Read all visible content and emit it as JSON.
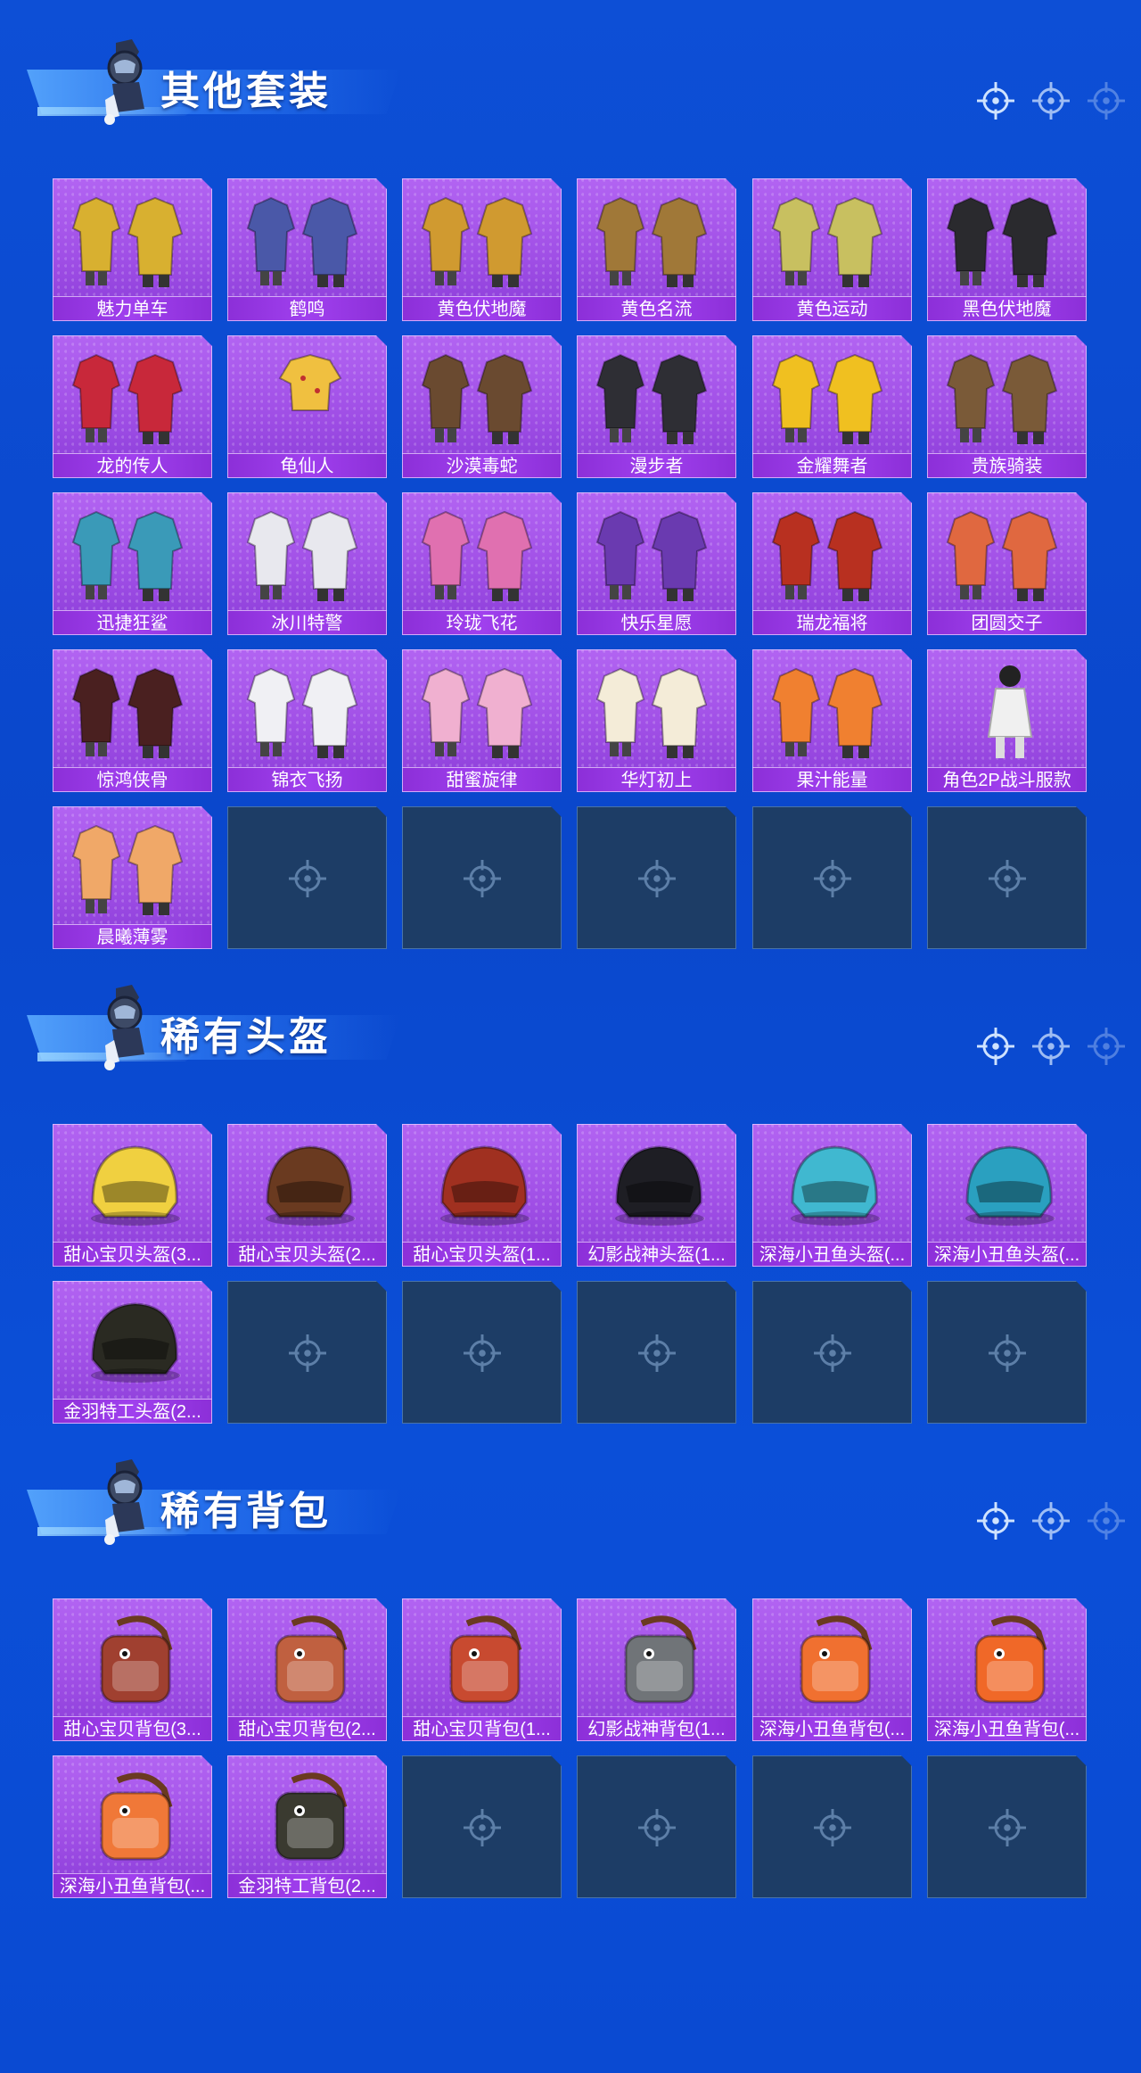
{
  "colors": {
    "background": "#0b4bd3",
    "tile": "#a04fe6",
    "label": "#8c2fd8",
    "empty": "#1d3d66"
  },
  "sections": [
    {
      "title": "其他套装",
      "items": [
        {
          "label": "魅力单车",
          "icon": "outfit-icon",
          "color": "#d8b030"
        },
        {
          "label": "鹤鸣",
          "icon": "jacket-icon",
          "color": "#4a58a8"
        },
        {
          "label": "黄色伏地魔",
          "icon": "hoodie-icon",
          "color": "#d09a30"
        },
        {
          "label": "黄色名流",
          "icon": "suit-icon",
          "color": "#a07838"
        },
        {
          "label": "黄色运动",
          "icon": "sport-outfit-icon",
          "color": "#c8c060"
        },
        {
          "label": "黑色伏地魔",
          "icon": "hoodie-icon",
          "color": "#2a2a2e"
        },
        {
          "label": "龙的传人",
          "icon": "robe-icon",
          "color": "#c8283a"
        },
        {
          "label": "龟仙人",
          "icon": "shirt-icon",
          "color": "#f0c040"
        },
        {
          "label": "沙漠毒蛇",
          "icon": "outfit-icon",
          "color": "#6a4a30"
        },
        {
          "label": "漫步者",
          "icon": "outfit-icon",
          "color": "#2e2e34"
        },
        {
          "label": "金耀舞者",
          "icon": "jacket-icon",
          "color": "#f0c020"
        },
        {
          "label": "贵族骑装",
          "icon": "outfit-icon",
          "color": "#7a5a38"
        },
        {
          "label": "迅捷狂鲨",
          "icon": "shark-outfit-icon",
          "color": "#3a9ab8"
        },
        {
          "label": "冰川特警",
          "icon": "jacket-icon",
          "color": "#e8e8ee"
        },
        {
          "label": "玲珑飞花",
          "icon": "dress-icon",
          "color": "#e070b0"
        },
        {
          "label": "快乐星愿",
          "icon": "armor-icon",
          "color": "#6a3ab0"
        },
        {
          "label": "瑞龙福将",
          "icon": "armor-icon",
          "color": "#b83020"
        },
        {
          "label": "团圆交子",
          "icon": "robe-icon",
          "color": "#e06840"
        },
        {
          "label": "惊鸿侠骨",
          "icon": "robe-icon",
          "color": "#4a2020"
        },
        {
          "label": "锦衣飞扬",
          "icon": "robe-icon",
          "color": "#f0f0f4"
        },
        {
          "label": "甜蜜旋律",
          "icon": "dress-icon",
          "color": "#f0b0d0"
        },
        {
          "label": "华灯初上",
          "icon": "robe-icon",
          "color": "#f4ecd8"
        },
        {
          "label": "果汁能量",
          "icon": "jacket-icon",
          "color": "#f08030"
        },
        {
          "label": "角色2P战斗服款",
          "icon": "figure-icon",
          "color": "#f0f0f0"
        },
        {
          "label": "晨曦薄雾",
          "icon": "dress-icon",
          "color": "#f0a868"
        }
      ],
      "empty_slots": 5
    },
    {
      "title": "稀有头盔",
      "items": [
        {
          "label": "甜心宝贝头盔(3...",
          "icon": "helmet-icon",
          "color": "#f0d040"
        },
        {
          "label": "甜心宝贝头盔(2...",
          "icon": "helmet-icon",
          "color": "#6a3a20"
        },
        {
          "label": "甜心宝贝头盔(1...",
          "icon": "helmet-icon",
          "color": "#a03020"
        },
        {
          "label": "幻影战神头盔(1...",
          "icon": "helmet-icon",
          "color": "#1e1e24"
        },
        {
          "label": "深海小丑鱼头盔(...",
          "icon": "helmet-icon",
          "color": "#40b8d0"
        },
        {
          "label": "深海小丑鱼头盔(...",
          "icon": "helmet-icon",
          "color": "#2aa0c0"
        },
        {
          "label": "金羽特工头盔(2...",
          "icon": "helmet-icon",
          "color": "#2a2a22"
        }
      ],
      "empty_slots": 5
    },
    {
      "title": "稀有背包",
      "items": [
        {
          "label": "甜心宝贝背包(3...",
          "icon": "backpack-icon",
          "color": "#a04030"
        },
        {
          "label": "甜心宝贝背包(2...",
          "icon": "backpack-icon",
          "color": "#c06040"
        },
        {
          "label": "甜心宝贝背包(1...",
          "icon": "backpack-icon",
          "color": "#c84a30"
        },
        {
          "label": "幻影战神背包(1...",
          "icon": "backpack-icon",
          "color": "#707478"
        },
        {
          "label": "深海小丑鱼背包(...",
          "icon": "backpack-icon",
          "color": "#f07030"
        },
        {
          "label": "深海小丑鱼背包(...",
          "icon": "backpack-icon",
          "color": "#f06828"
        },
        {
          "label": "深海小丑鱼背包(...",
          "icon": "backpack-icon",
          "color": "#f07838"
        },
        {
          "label": "金羽特工背包(2...",
          "icon": "backpack-icon",
          "color": "#3a3a30"
        }
      ],
      "empty_slots": 4
    }
  ]
}
